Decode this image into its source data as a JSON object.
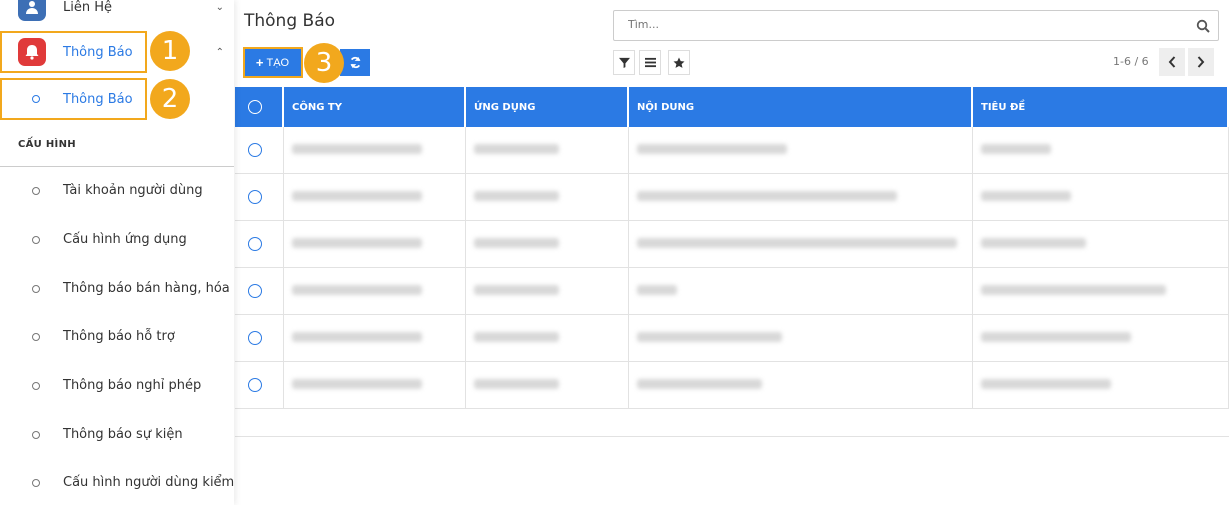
{
  "sidebar": {
    "contact": {
      "label": "Liên Hệ",
      "icon": "contact-icon"
    },
    "notifications": {
      "label": "Thông Báo",
      "icon": "bell-icon",
      "accent": "#e03a3a"
    },
    "submenu": {
      "label": "Thông Báo"
    },
    "config_section": "CẤU HÌNH",
    "config_items": [
      "Tài khoản người dùng",
      "Cấu hình ứng dụng",
      "Thông báo bán hàng, hóa đơn",
      "Thông báo hỗ trợ",
      "Thông báo nghỉ phép",
      "Thông báo sự kiện",
      "Cấu hình người dùng kiểm thử"
    ]
  },
  "badges": [
    "1",
    "2",
    "3"
  ],
  "main": {
    "title": "Thông Báo",
    "search_placeholder": "Tìm...",
    "create_label": "TẠO",
    "pager": "1-6 / 6"
  },
  "table": {
    "columns": [
      "CÔNG TY",
      "ỨNG DỤNG",
      "NỘI DUNG",
      "TIÊU ĐỀ"
    ]
  },
  "colors": {
    "primary": "#2b7ae4",
    "highlight": "#f2a81d"
  }
}
